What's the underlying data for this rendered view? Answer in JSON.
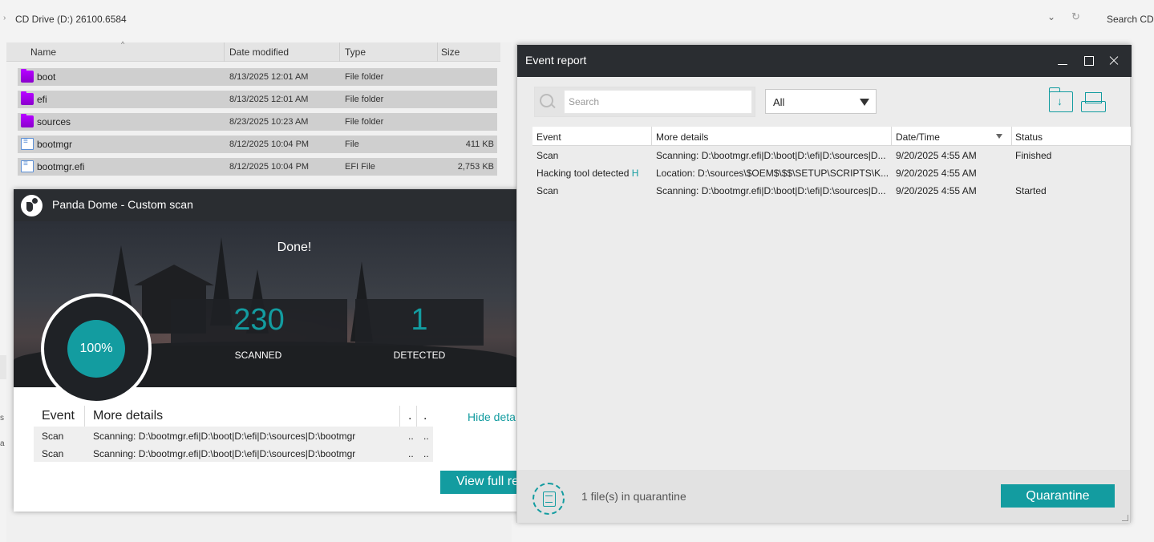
{
  "explorer": {
    "address": "CD Drive (D:) 26100.6584",
    "search_placeholder": "Search CD D",
    "columns": [
      "Name",
      "Date modified",
      "Type",
      "Size"
    ],
    "files": [
      {
        "name": "boot",
        "date": "8/13/2025 12:01 AM",
        "type": "File folder",
        "size": "",
        "icon": "folder-icon"
      },
      {
        "name": "efi",
        "date": "8/13/2025 12:01 AM",
        "type": "File folder",
        "size": "",
        "icon": "folder-icon"
      },
      {
        "name": "sources",
        "date": "8/23/2025 10:23 AM",
        "type": "File folder",
        "size": "",
        "icon": "folder-icon"
      },
      {
        "name": "bootmgr",
        "date": "8/12/2025 10:04 PM",
        "type": "File",
        "size": "411 KB",
        "icon": "file-icon"
      },
      {
        "name": "bootmgr.efi",
        "date": "8/12/2025 10:04 PM",
        "type": "EFI File",
        "size": "2,753 KB",
        "icon": "file-icon"
      }
    ]
  },
  "panda": {
    "title": "Panda Dome - Custom scan",
    "status": "Done!",
    "progress": "100%",
    "progress_fraction": 1.0,
    "scanned_count": "230",
    "scanned_label": "SCANNED",
    "detected_count": "1",
    "detected_label": "DETECTED",
    "table_headers": [
      "Event",
      "More details",
      ".",
      "."
    ],
    "rows": [
      {
        "event": "Scan",
        "details": "Scanning: D:\\bootmgr.efi|D:\\boot|D:\\efi|D:\\sources|D:\\bootmgr",
        "c3": "..",
        "c4": ".."
      },
      {
        "event": "Scan",
        "details": "Scanning: D:\\bootmgr.efi|D:\\boot|D:\\efi|D:\\sources|D:\\bootmgr",
        "c3": "..",
        "c4": ".."
      }
    ],
    "hide_details": "Hide deta",
    "view_full": "View full re"
  },
  "report": {
    "title": "Event report",
    "search_placeholder": "Search",
    "filter_value": "All",
    "columns": [
      "Event",
      "More details",
      "Date/Time",
      "Status"
    ],
    "rows": [
      {
        "event": "Scan",
        "event_link": "",
        "details": "Scanning: D:\\bootmgr.efi|D:\\boot|D:\\efi|D:\\sources|D...",
        "datetime": "9/20/2025 4:55 AM",
        "status": "Finished"
      },
      {
        "event": "Hacking tool detected ",
        "event_link": "H",
        "details": "Location: D:\\sources\\$OEM$\\$$\\SETUP\\SCRIPTS\\K...",
        "datetime": "9/20/2025 4:55 AM",
        "status": ""
      },
      {
        "event": "Scan",
        "event_link": "",
        "details": "Scanning: D:\\bootmgr.efi|D:\\boot|D:\\efi|D:\\sources|D...",
        "datetime": "9/20/2025 4:55 AM",
        "status": "Started"
      }
    ],
    "quarantine_count": "1 file(s) in quarantine",
    "quarantine_button": "Quarantine"
  },
  "colors": {
    "accent": "#139ca0",
    "titlebar": "#2a2d31",
    "folder": "#b400ff"
  }
}
